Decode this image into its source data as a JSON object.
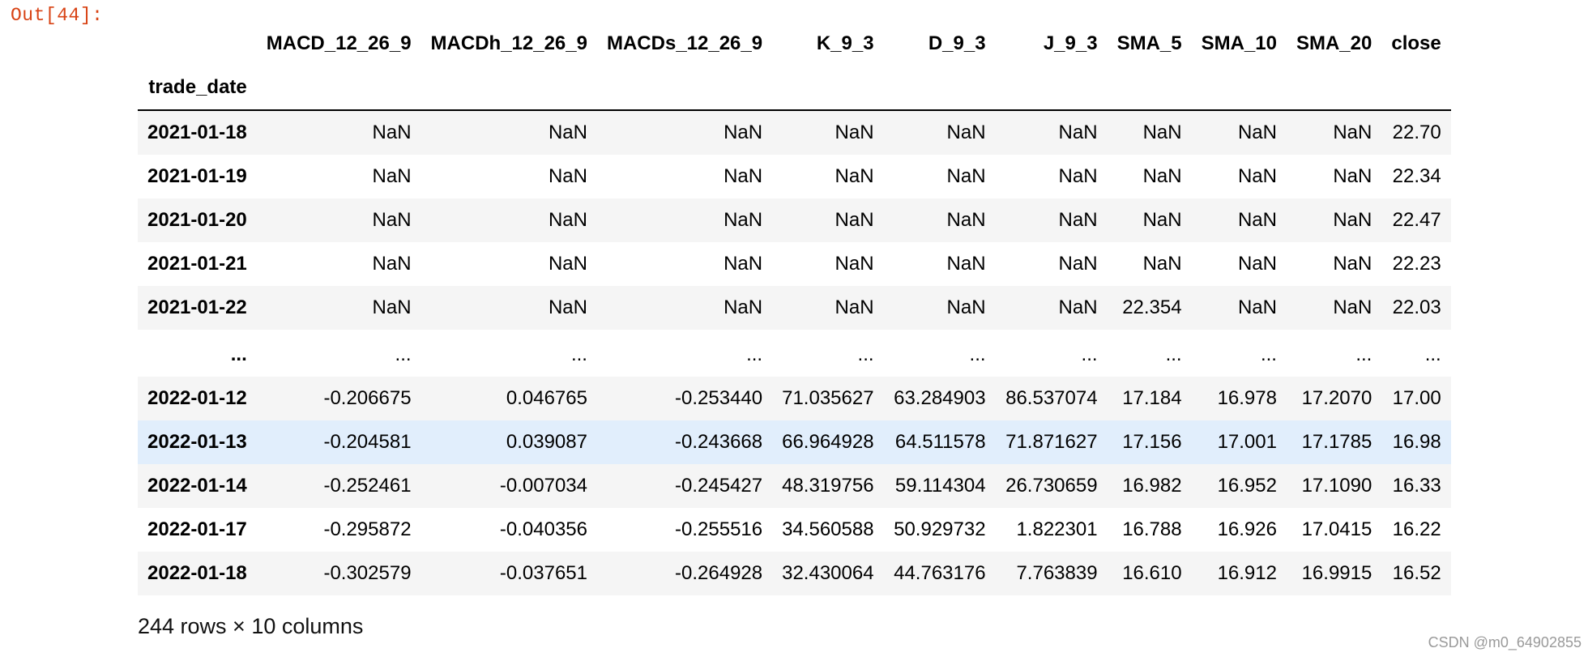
{
  "cell": {
    "out_prompt": "Out[44]:"
  },
  "dataframe": {
    "columns": [
      "MACD_12_26_9",
      "MACDh_12_26_9",
      "MACDs_12_26_9",
      "K_9_3",
      "D_9_3",
      "J_9_3",
      "SMA_5",
      "SMA_10",
      "SMA_20",
      "close"
    ],
    "index_name": "trade_date",
    "rows": [
      {
        "index": "2021-01-18",
        "values": [
          "NaN",
          "NaN",
          "NaN",
          "NaN",
          "NaN",
          "NaN",
          "NaN",
          "NaN",
          "NaN",
          "22.70"
        ]
      },
      {
        "index": "2021-01-19",
        "values": [
          "NaN",
          "NaN",
          "NaN",
          "NaN",
          "NaN",
          "NaN",
          "NaN",
          "NaN",
          "NaN",
          "22.34"
        ]
      },
      {
        "index": "2021-01-20",
        "values": [
          "NaN",
          "NaN",
          "NaN",
          "NaN",
          "NaN",
          "NaN",
          "NaN",
          "NaN",
          "NaN",
          "22.47"
        ]
      },
      {
        "index": "2021-01-21",
        "values": [
          "NaN",
          "NaN",
          "NaN",
          "NaN",
          "NaN",
          "NaN",
          "NaN",
          "NaN",
          "NaN",
          "22.23"
        ]
      },
      {
        "index": "2021-01-22",
        "values": [
          "NaN",
          "NaN",
          "NaN",
          "NaN",
          "NaN",
          "NaN",
          "22.354",
          "NaN",
          "NaN",
          "22.03"
        ]
      },
      {
        "index": "...",
        "values": [
          "...",
          "...",
          "...",
          "...",
          "...",
          "...",
          "...",
          "...",
          "...",
          "..."
        ]
      },
      {
        "index": "2022-01-12",
        "values": [
          "-0.206675",
          "0.046765",
          "-0.253440",
          "71.035627",
          "63.284903",
          "86.537074",
          "17.184",
          "16.978",
          "17.2070",
          "17.00"
        ]
      },
      {
        "index": "2022-01-13",
        "values": [
          "-0.204581",
          "0.039087",
          "-0.243668",
          "66.964928",
          "64.511578",
          "71.871627",
          "17.156",
          "17.001",
          "17.1785",
          "16.98"
        ]
      },
      {
        "index": "2022-01-14",
        "values": [
          "-0.252461",
          "-0.007034",
          "-0.245427",
          "48.319756",
          "59.114304",
          "26.730659",
          "16.982",
          "16.952",
          "17.1090",
          "16.33"
        ]
      },
      {
        "index": "2022-01-17",
        "values": [
          "-0.295872",
          "-0.040356",
          "-0.255516",
          "34.560588",
          "50.929732",
          "1.822301",
          "16.788",
          "16.926",
          "17.0415",
          "16.22"
        ]
      },
      {
        "index": "2022-01-18",
        "values": [
          "-0.302579",
          "-0.037651",
          "-0.264928",
          "32.430064",
          "44.763176",
          "7.763839",
          "16.610",
          "16.912",
          "16.9915",
          "16.52"
        ]
      }
    ],
    "hovered_row_index": "2022-01-13",
    "shape_text": "244 rows × 10 columns"
  },
  "watermark": "CSDN @m0_64902855",
  "colors": {
    "prompt": "#d84315",
    "row_stripe": "#f5f5f5",
    "row_hover": "#e1eefc",
    "header_rule": "#000000"
  }
}
